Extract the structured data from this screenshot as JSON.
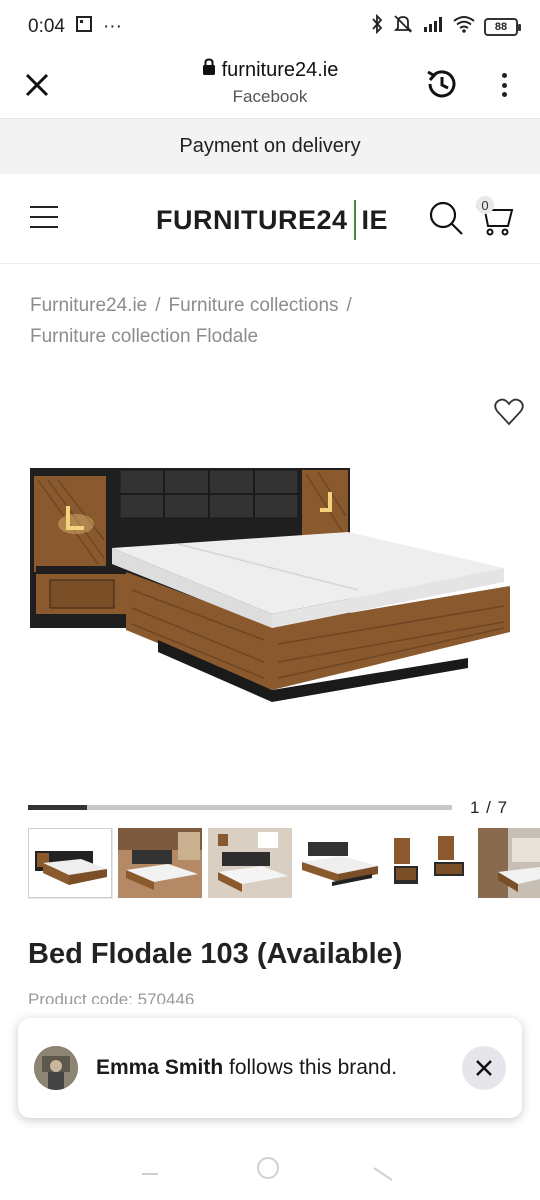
{
  "status_bar": {
    "time": "0:04",
    "dots": "···",
    "battery": "88"
  },
  "browser": {
    "url": "furniture24.ie",
    "source": "Facebook"
  },
  "banner": {
    "text": "Payment on delivery"
  },
  "header": {
    "logo_main": "FURNITURE24",
    "logo_suffix": "IE",
    "cart_count": "0"
  },
  "breadcrumb": {
    "items": [
      "Furniture24.ie",
      "Furniture collections",
      "Furniture collection Flodale"
    ],
    "separator": "/"
  },
  "gallery": {
    "page_indicator": "1 / 7",
    "progress": 0.14,
    "thumbnail_count": 6
  },
  "product": {
    "title": "Bed Flodale 103 (Available)",
    "code": "Product code: 570446"
  },
  "toast": {
    "name": "Emma Smith",
    "message": "follows this brand."
  },
  "colors": {
    "wood": "#8a5a2e",
    "wood_dark": "#5e3a1c",
    "headboard": "#2a2a2a",
    "mattress": "#eeeeee",
    "logo_separator": "#3e8a3e"
  }
}
